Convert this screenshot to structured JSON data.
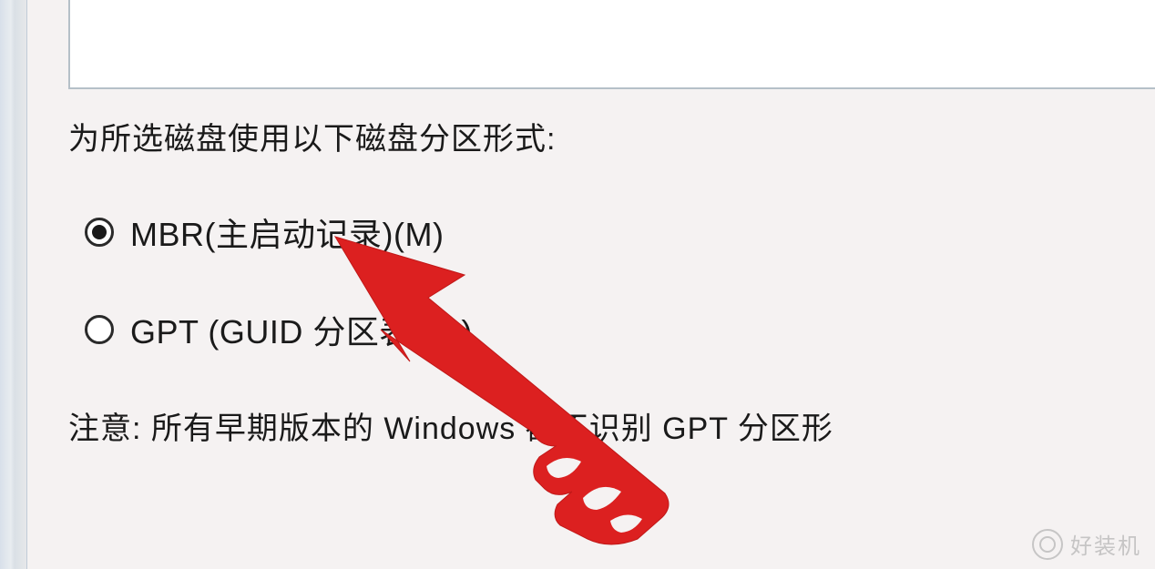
{
  "dialog": {
    "section_title": "为所选磁盘使用以下磁盘分区形式:",
    "options": {
      "mbr": {
        "label": "MBR(主启动记录)(M)",
        "selected": true
      },
      "gpt": {
        "label": "GPT (GUID 分区表)(G)",
        "selected": false
      }
    },
    "note": "注意: 所有早期版本的 Windows 都不识别 GPT 分区形"
  },
  "watermark": {
    "text": "好装机"
  },
  "colors": {
    "arrow": "#dc2020",
    "background": "#f5f2f2",
    "text": "#1a1a1a"
  }
}
